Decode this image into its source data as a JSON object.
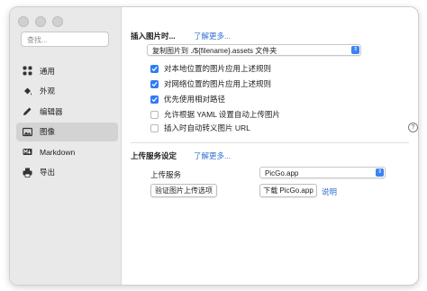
{
  "sidebar": {
    "search_placeholder": "查找...",
    "items": [
      {
        "label": "通用",
        "icon": "grid-icon"
      },
      {
        "label": "外观",
        "icon": "paint-bucket-icon"
      },
      {
        "label": "编辑器",
        "icon": "pencil-icon"
      },
      {
        "label": "图像",
        "icon": "image-icon",
        "active": true
      },
      {
        "label": "Markdown",
        "icon": "markdown-icon"
      },
      {
        "label": "导出",
        "icon": "printer-icon"
      }
    ]
  },
  "insert_image": {
    "title": "插入图片时...",
    "learn_more": "了解更多...",
    "action_select": "复制图片到 ./${filename}.assets 文件夹",
    "options": [
      {
        "label": "对本地位置的图片应用上述规则",
        "checked": true
      },
      {
        "label": "对网络位置的图片应用上述规则",
        "checked": true
      },
      {
        "label": "优先使用相对路径",
        "checked": true
      },
      {
        "label": "允许根据 YAML 设置自动上传图片",
        "checked": false
      },
      {
        "label": "插入时自动转义图片 URL",
        "checked": false
      }
    ],
    "help": "?"
  },
  "upload_service": {
    "title": "上传服务设定",
    "learn_more": "了解更多...",
    "service_label": "上传服务",
    "service_select": "PicGo.app",
    "verify_button": "验证图片上传选项",
    "download_button": "下载 PicGo.app",
    "explain_link": "说明"
  },
  "colors": {
    "accent": "#2f7cf6",
    "link": "#2f6fd1",
    "sidebar_bg": "#e9e9e9",
    "active_item": "#d3d3d3"
  }
}
